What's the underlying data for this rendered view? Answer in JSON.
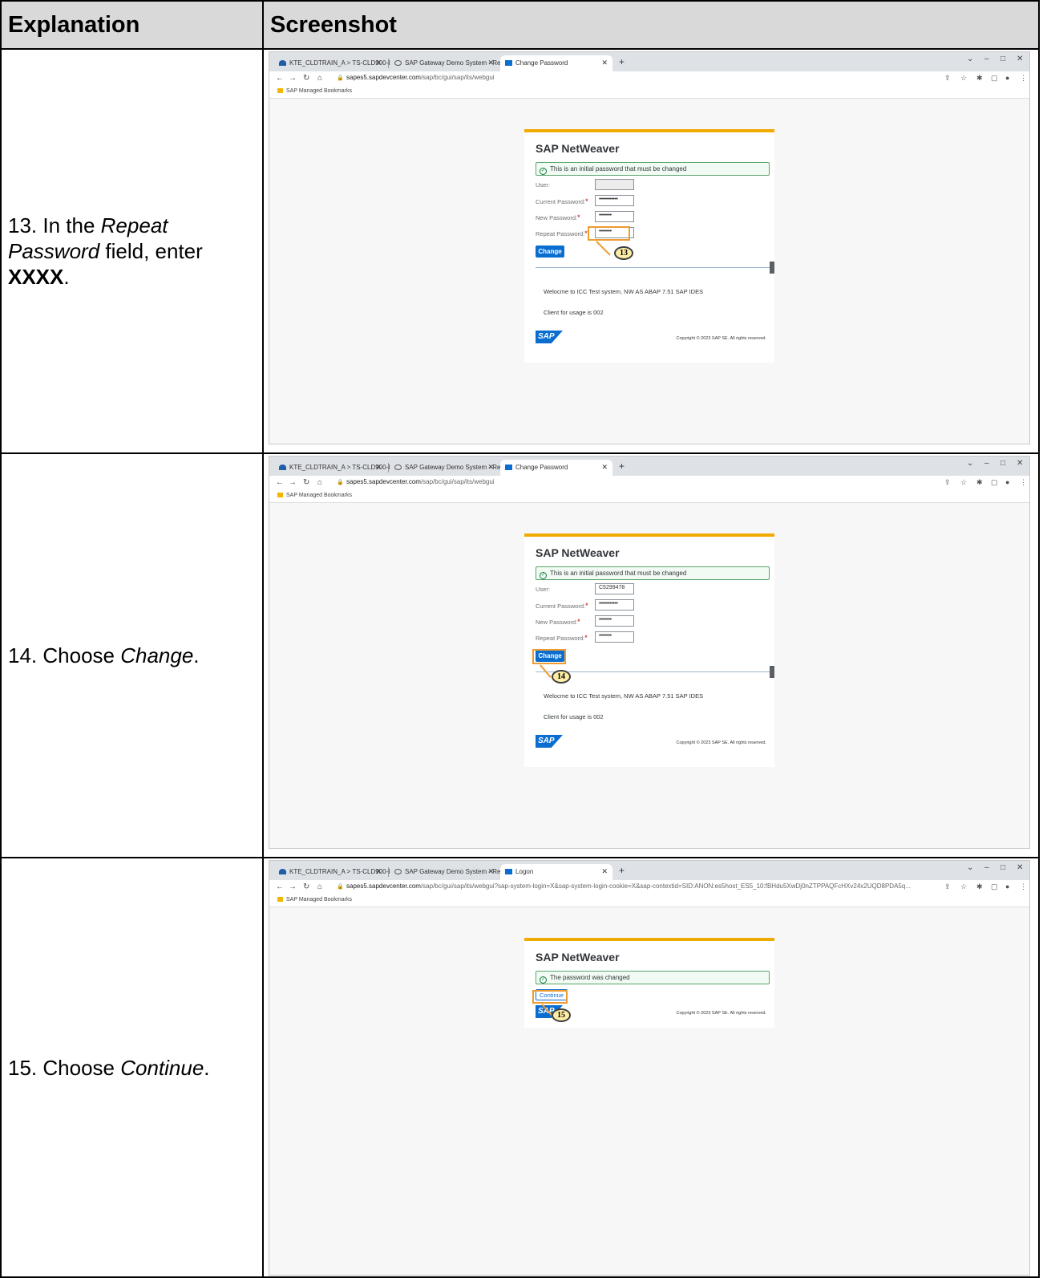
{
  "header": {
    "col1": "Explanation",
    "col2": "Screenshot"
  },
  "steps": [
    {
      "explain_parts": {
        "num": "13. In the ",
        "field": "Repeat Password",
        "mid": " field, enter ",
        "value": "XXXX",
        "end": "."
      },
      "tab_title": "Change Password",
      "url_host": "sapes5.sapdevcenter.com",
      "url_path": "/sap/bc/gui/sap/its/webgui",
      "message": "This is an initial password that must be changed",
      "fields": [
        {
          "label": "User:",
          "value": "",
          "required": false
        },
        {
          "label": "Current Password:",
          "value": "••••••••••••",
          "required": true
        },
        {
          "label": "New Password:",
          "value": "••••••••",
          "required": true
        },
        {
          "label": "Repeat Password:",
          "value": "••••••••",
          "required": true
        }
      ],
      "button": "Change",
      "callout": "13"
    },
    {
      "explain_parts": {
        "num": "14. Choose ",
        "target": "Change",
        "end": "."
      },
      "tab_title": "Change Password",
      "url_host": "sapes5.sapdevcenter.com",
      "url_path": "/sap/bc/gui/sap/its/webgui",
      "message": "This is an initial password that must be changed",
      "fields": [
        {
          "label": "User:",
          "value": "C5299478",
          "required": false
        },
        {
          "label": "Current Password:",
          "value": "••••••••••••",
          "required": true
        },
        {
          "label": "New Password:",
          "value": "••••••••",
          "required": true
        },
        {
          "label": "Repeat Password:",
          "value": "••••••••",
          "required": true
        }
      ],
      "button": "Change",
      "callout": "14"
    },
    {
      "explain_parts": {
        "num": "15. Choose ",
        "target": "Continue",
        "end": "."
      },
      "tab_title": "Logon",
      "url_host": "sapes5.sapdevcenter.com",
      "url_path": "/sap/bc/gui/sap/its/webgui?sap-system-login=X&sap-system-login-cookie=X&sap-contextid=SID:ANON:es5host_ES5_10:fBHdu5XwDj0nZTPPAQFcHXv24x2UQD8PDA5q...",
      "message": "The password was changed",
      "button": "Continue",
      "callout": "15"
    }
  ],
  "browser": {
    "tab1": "KTE_CLDTRAIN_A > TS-CLD900-I",
    "tab2": "SAP Gateway Demo System - Re",
    "bookmarks": "SAP Managed Bookmarks"
  },
  "sap": {
    "product": "SAP NetWeaver",
    "welcome": "Welocme to ICC Test system, NW AS ABAP 7.51 SAP IDES",
    "client": "Client for usage is 002",
    "logo": "SAP",
    "copyright": "Copyright © 2023 SAP SE. All rights reserved."
  },
  "colors": {
    "accent_bar": "#f0ab00",
    "button": "#0a6ed1",
    "highlight": "#ee9b2f",
    "callout_fill": "#ffeea5"
  }
}
